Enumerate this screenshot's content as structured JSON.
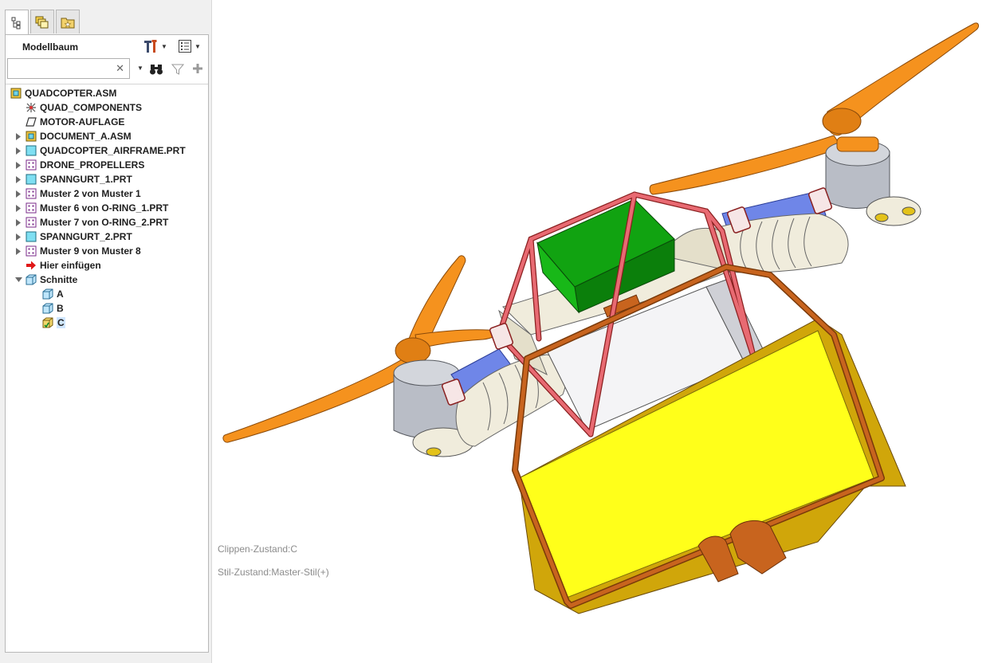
{
  "navigator": {
    "tabs": [
      {
        "icon": "model-tree-tab-icon",
        "active": true
      },
      {
        "icon": "layers-tab-icon",
        "active": false
      },
      {
        "icon": "favorites-folder-tab-icon",
        "active": false
      }
    ],
    "title": "Modellbaum",
    "search": {
      "value": "",
      "placeholder": ""
    },
    "tree": [
      {
        "label": "QUADCOPTER.ASM",
        "icon": "assembly-icon",
        "expander": "none"
      },
      {
        "label": "QUAD_COMPONENTS",
        "icon": "component-feature-icon",
        "expander": "none"
      },
      {
        "label": "MOTOR-AUFLAGE",
        "icon": "datum-plane-icon",
        "expander": "none"
      },
      {
        "label": "DOCUMENT_A.ASM",
        "icon": "assembly-icon",
        "expander": "collapsed"
      },
      {
        "label": "QUADCOPTER_AIRFRAME.PRT",
        "icon": "part-icon",
        "expander": "collapsed"
      },
      {
        "label": "DRONE_PROPELLERS",
        "icon": "pattern-icon",
        "expander": "collapsed"
      },
      {
        "label": "SPANNGURT_1.PRT",
        "icon": "part-icon",
        "expander": "collapsed"
      },
      {
        "label": "Muster 2 von Muster 1",
        "icon": "pattern-icon",
        "expander": "collapsed"
      },
      {
        "label": "Muster 6 von O-RING_1.PRT",
        "icon": "pattern-icon",
        "expander": "collapsed"
      },
      {
        "label": "Muster 7 von O-RING_2.PRT",
        "icon": "pattern-icon",
        "expander": "collapsed"
      },
      {
        "label": "SPANNGURT_2.PRT",
        "icon": "part-icon",
        "expander": "collapsed"
      },
      {
        "label": "Muster 9 von Muster 8",
        "icon": "pattern-icon",
        "expander": "collapsed"
      },
      {
        "label": "Hier einfügen",
        "icon": "insert-here-arrow-icon",
        "expander": "none"
      },
      {
        "label": "Schnitte",
        "icon": "sections-folder-icon",
        "expander": "expanded"
      },
      {
        "label": "A",
        "icon": "section-icon",
        "expander": "none"
      },
      {
        "label": "B",
        "icon": "section-icon",
        "expander": "none"
      },
      {
        "label": "C",
        "icon": "active-section-icon",
        "expander": "none",
        "selected": true
      }
    ]
  },
  "graphics": {
    "clip_state": "Clippen-Zustand:C",
    "style_state": "Stil-Zustand:Master-Stil(+)"
  },
  "colors": {
    "propeller": "#f5921e",
    "motor": "#b9bdc6",
    "arm": "#6f86e8",
    "frame_tube": "#e05660",
    "battery": "#11a311",
    "case": "#ffff1a",
    "case_rim": "#c8641e",
    "airframe": "#f0ecdc"
  }
}
